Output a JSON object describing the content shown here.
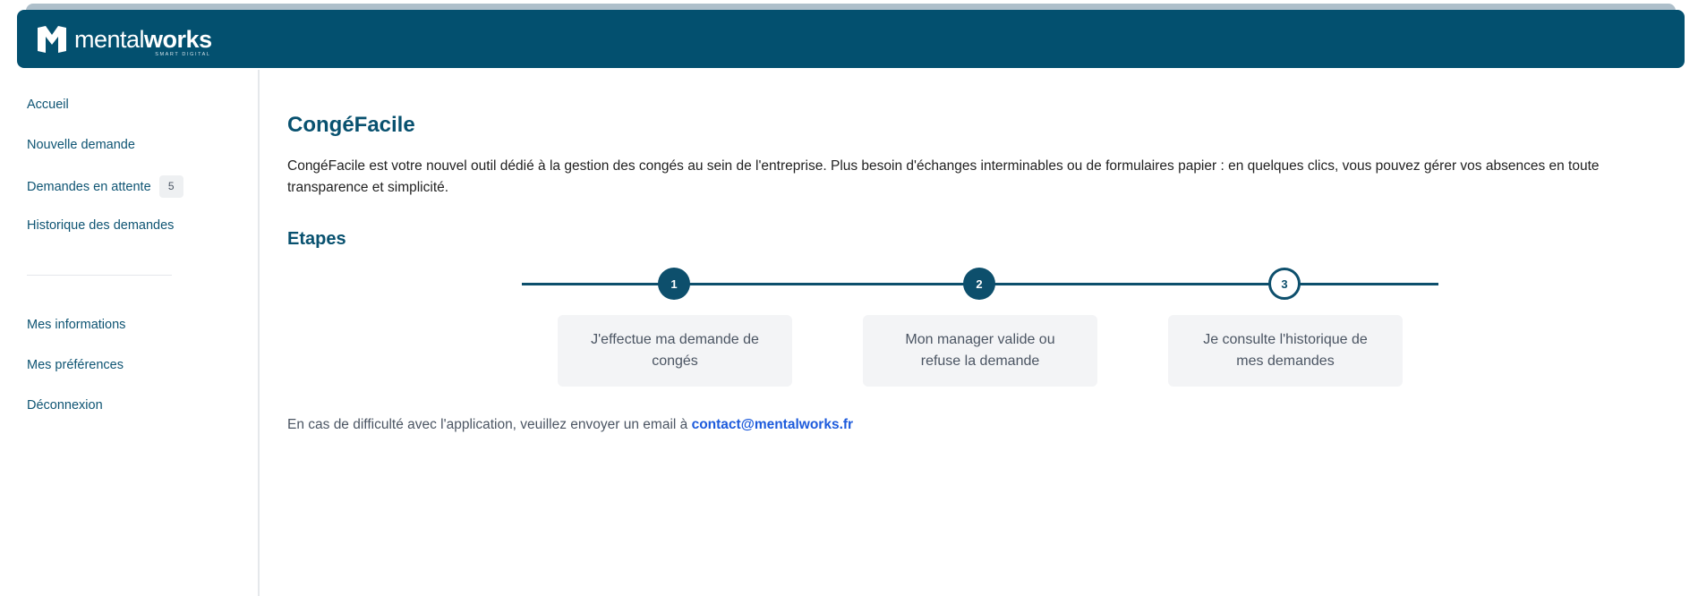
{
  "brand": {
    "name_light": "mental",
    "name_bold": "works",
    "tagline": "SMART DIGITAL"
  },
  "colors": {
    "header_bg": "#03506f",
    "accent": "#0d4f6c",
    "link": "#1d5bdc",
    "step_box_bg": "#f3f4f6"
  },
  "sidebar": {
    "items": [
      {
        "label": "Accueil"
      },
      {
        "label": "Nouvelle demande"
      },
      {
        "label": "Demandes en attente",
        "badge": "5"
      },
      {
        "label": "Historique des demandes"
      },
      {
        "label": "Mes informations"
      },
      {
        "label": "Mes préférences"
      },
      {
        "label": "Déconnexion"
      }
    ]
  },
  "main": {
    "title": "CongéFacile",
    "intro": "CongéFacile est votre nouvel outil dédié à la gestion des congés au sein de l'entreprise. Plus besoin d'échanges interminables ou de formulaires papier : en quelques clics, vous pouvez gérer vos absences en toute transparence et simplicité.",
    "steps_title": "Etapes",
    "steps": [
      {
        "number": "1",
        "text": "J'effectue ma demande de congés"
      },
      {
        "number": "2",
        "text": "Mon manager valide ou refuse la demande"
      },
      {
        "number": "3",
        "text": "Je consulte l'historique de mes demandes"
      }
    ],
    "contact_text": "En cas de difficulté avec l'application, veuillez envoyer un email à",
    "contact_email": "contact@mentalworks.fr"
  }
}
